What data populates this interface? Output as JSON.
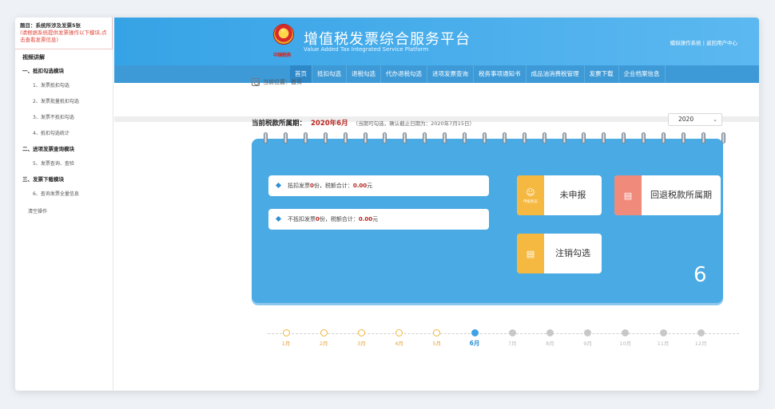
{
  "task": {
    "title": "题目：系统所涉及发票5张",
    "note": "(请根据系统提供发票操作以下模块,点击查看发票信息)"
  },
  "guide": {
    "heading": "视频讲解",
    "sections": [
      {
        "title": "一、抵扣勾选模块",
        "items": [
          "1、发票抵扣勾选",
          "2、发票批量抵扣勾选",
          "3、发票不抵扣勾选",
          "4、抵扣勾选统计"
        ]
      },
      {
        "title": "二、进项发票查询模块",
        "items": [
          "5、发票查询、查验"
        ]
      },
      {
        "title": "三、发票下载模块",
        "items": [
          "6、查询发票全量信息"
        ]
      }
    ],
    "clear": "清空操作"
  },
  "header": {
    "emblem_text": "中国税务",
    "title": "增值税发票综合服务平台",
    "subtitle": "Value Added Tax Integrated Service Platform",
    "links": "模拟操作系统 | 返回用户中心"
  },
  "nav": [
    "首页",
    "抵扣勾选",
    "退税勾选",
    "代办退税勾选",
    "进项发票查询",
    "税务事项通知书",
    "成品油消费税管理",
    "发票下载",
    "企业档案信息"
  ],
  "breadcrumb": "当前位置：首页",
  "period": {
    "label": "当前税款所属期：",
    "value": "2020年6月",
    "note": "（当期可勾选，确认截止日期为：2020年7月15日）"
  },
  "year": "2020",
  "summary": {
    "deduct_prefix": "抵扣发票",
    "deduct_count": "0",
    "deduct_mid": "份，税额合计：",
    "deduct_amount": "0.00",
    "deduct_suffix": "元",
    "nondeduct_prefix": "不抵扣发票",
    "nondeduct_count": "0",
    "nondeduct_mid": "份，税额合计：",
    "nondeduct_amount": "0.00",
    "nondeduct_suffix": "元"
  },
  "tiles": {
    "declare_status_caption": "申报状态",
    "declare_status": "未申报",
    "rollback": "回退税款所属期",
    "cancel": "注销勾选"
  },
  "current_month": "6",
  "months": [
    "1月",
    "2月",
    "3月",
    "4月",
    "5月",
    "6月",
    "7月",
    "8月",
    "9月",
    "10月",
    "11月",
    "12月"
  ],
  "colors": {
    "header": "#36a3e6",
    "nav": "#3d9ad7",
    "card": "#4aaae3",
    "orange": "#f5b942",
    "salmon": "#f08a7b",
    "accent_red": "#b7261f"
  }
}
